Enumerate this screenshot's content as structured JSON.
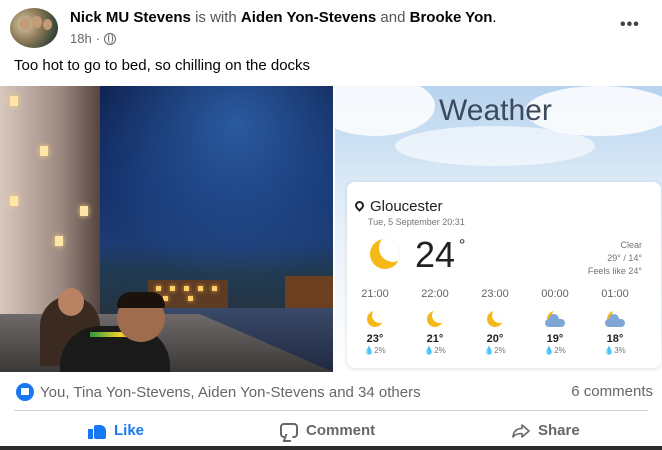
{
  "post": {
    "author": "Nick MU Stevens",
    "is_with": "is with",
    "tagged_1": "Aiden Yon-Stevens",
    "and_word": "and",
    "tagged_2": "Brooke Yon",
    "period": ".",
    "time": "18h",
    "privacy_icon": "globe-icon",
    "more_label": "•••",
    "message": "Too hot to go to bed, so chilling on the docks"
  },
  "weather": {
    "title": "Weather",
    "location": "Gloucester",
    "date": "Tue, 5 September 20:31",
    "temp": "24",
    "deg": "°",
    "condition": "Clear",
    "hi_lo": "29° / 14°",
    "feels_like": "Feels like 24°",
    "hourly": [
      {
        "time": "21:00",
        "icon": "moon-icon",
        "temp": "23°",
        "precip": "2%"
      },
      {
        "time": "22:00",
        "icon": "moon-icon",
        "temp": "21°",
        "precip": "2%"
      },
      {
        "time": "23:00",
        "icon": "moon-icon",
        "temp": "20°",
        "precip": "2%"
      },
      {
        "time": "00:00",
        "icon": "cloudy-moon-icon",
        "temp": "19°",
        "precip": "2%"
      },
      {
        "time": "01:00",
        "icon": "cloudy-moon-icon",
        "temp": "18°",
        "precip": "3%"
      }
    ]
  },
  "reactions": {
    "text": "You, Tina Yon-Stevens, Aiden Yon-Stevens and 34 others",
    "comments": "6 comments"
  },
  "actions": {
    "like": "Like",
    "comment": "Comment",
    "share": "Share"
  }
}
